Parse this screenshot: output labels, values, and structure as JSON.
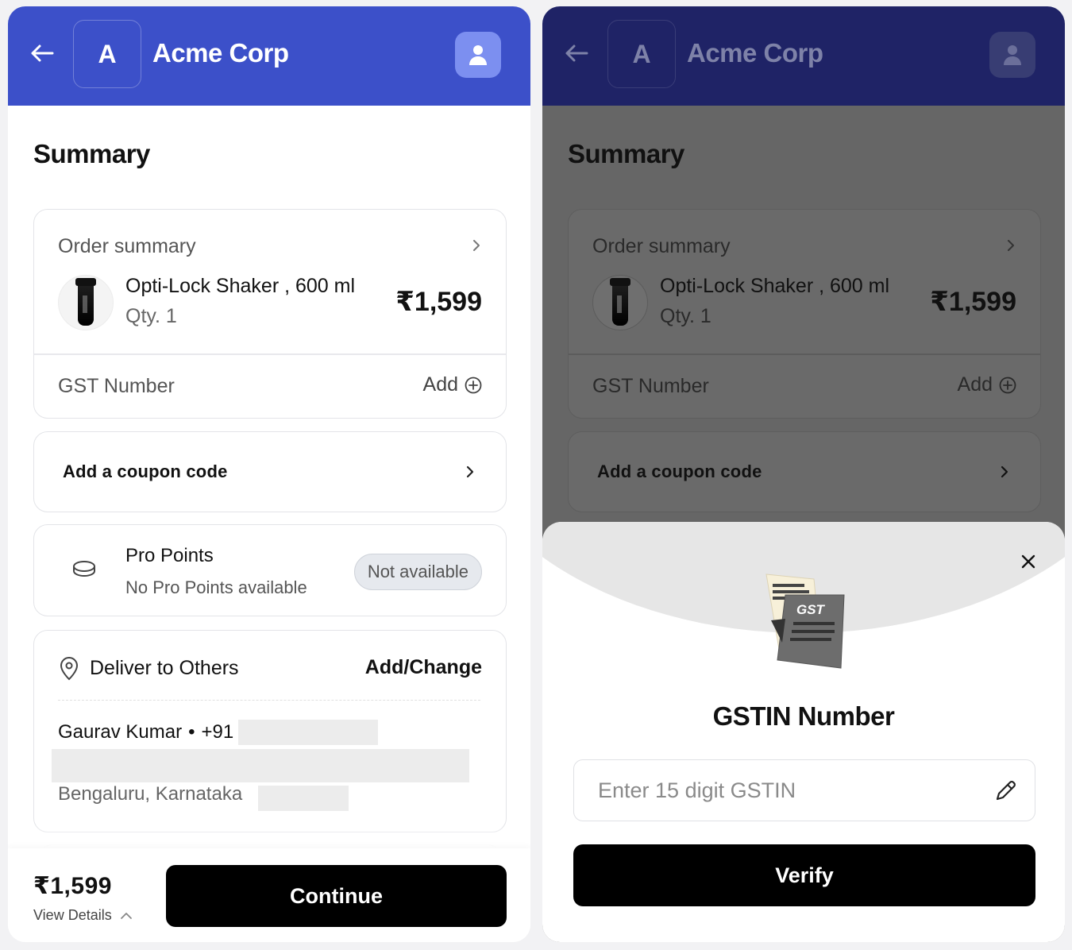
{
  "header": {
    "logo_letter": "A",
    "brand_name": "Acme Corp"
  },
  "summary": {
    "title": "Summary",
    "order_summary_label": "Order summary",
    "product_name": "Opti-Lock Shaker , 600 ml",
    "product_qty": "Qty. 1",
    "product_price": "₹1,599",
    "gst_label": "GST Number",
    "gst_add": "Add"
  },
  "coupon": {
    "label": "Add a coupon code"
  },
  "pro_points": {
    "title": "Pro Points",
    "subtitle": "No Pro Points available",
    "badge": "Not available"
  },
  "delivery": {
    "title": "Deliver to Others",
    "action": "Add/Change",
    "recipient_name": "Gaurav Kumar",
    "separator": "•",
    "phone_prefix": "+91",
    "city_line": "Bengaluru, Karnataka"
  },
  "bottom_bar": {
    "total": "₹1,599",
    "view_details": "View Details",
    "continue_label": "Continue"
  },
  "gstin_sheet": {
    "illustration_label": "GST",
    "title": "GSTIN Number",
    "placeholder": "Enter 15 digit GSTIN",
    "value": "",
    "verify_label": "Verify"
  },
  "colors": {
    "header_active": "#3c50c9",
    "header_dimmed": "#1f2366",
    "primary_button": "#000000"
  }
}
